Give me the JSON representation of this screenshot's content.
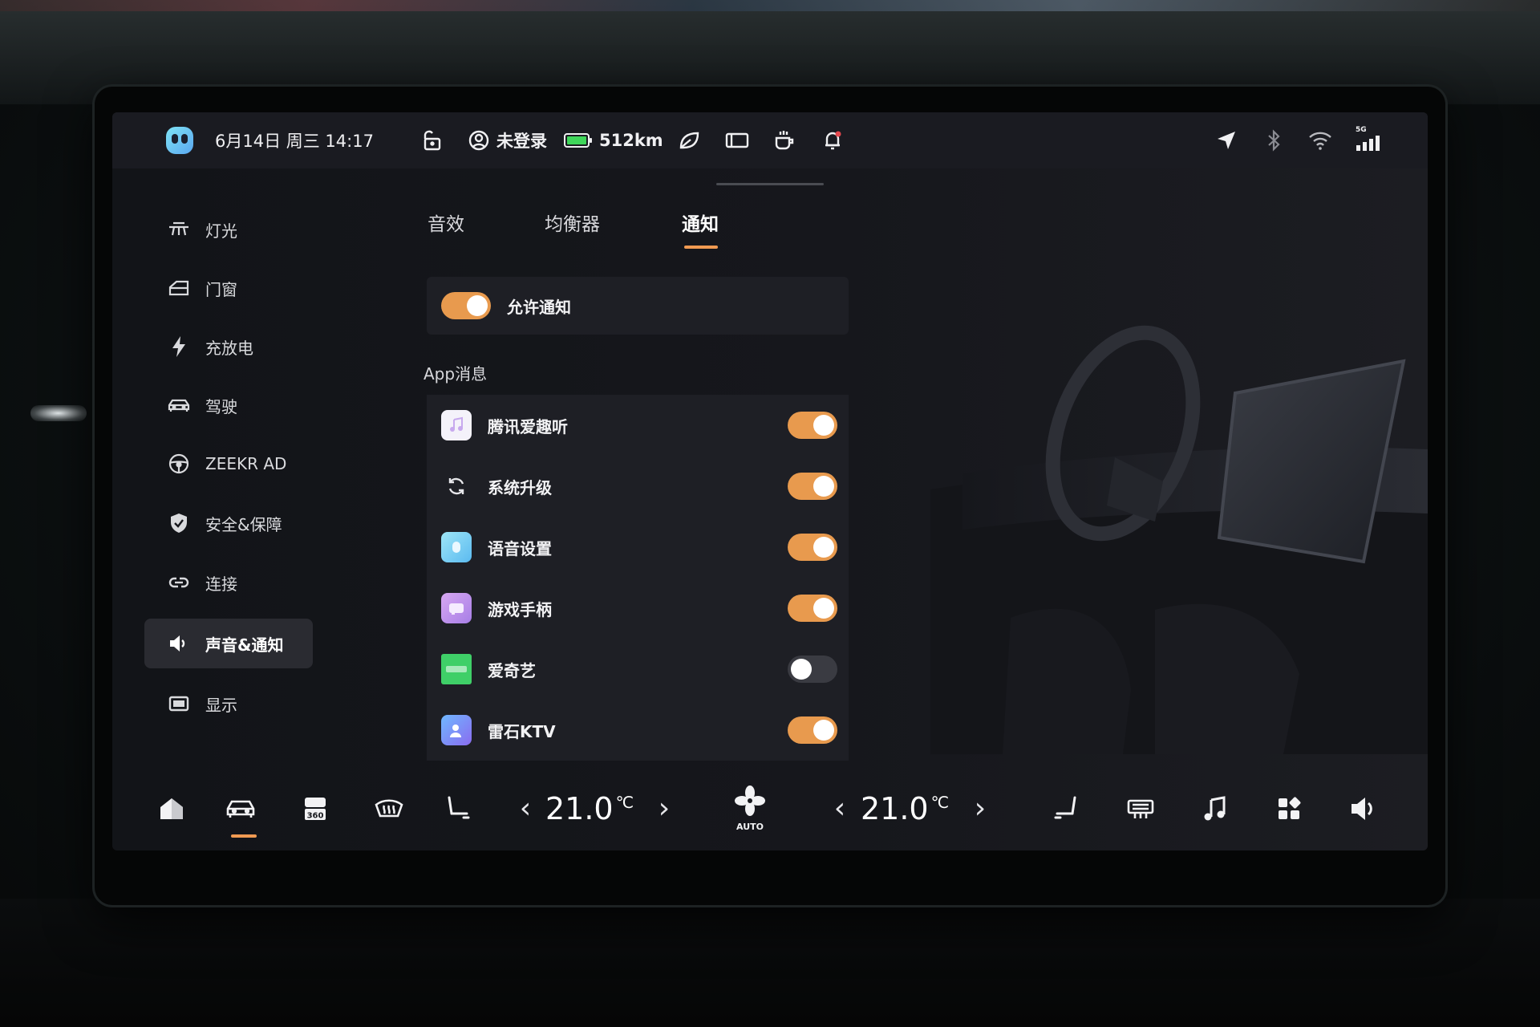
{
  "status_bar": {
    "date_time": "6月14日 周三 14:17",
    "user": "未登录",
    "range": "512km",
    "network_badge": "5G"
  },
  "sidebar": {
    "items": [
      {
        "label": "灯光",
        "icon": "light-icon"
      },
      {
        "label": "门窗",
        "icon": "door-icon"
      },
      {
        "label": "充放电",
        "icon": "bolt-icon"
      },
      {
        "label": "驾驶",
        "icon": "car-icon"
      },
      {
        "label": "ZEEKR AD",
        "icon": "steering-wheel-icon"
      },
      {
        "label": "安全&保障",
        "icon": "shield-icon"
      },
      {
        "label": "连接",
        "icon": "link-icon"
      },
      {
        "label": "声音&通知",
        "icon": "speaker-icon",
        "active": true
      },
      {
        "label": "显示",
        "icon": "display-icon"
      }
    ]
  },
  "tabs": [
    {
      "label": "音效"
    },
    {
      "label": "均衡器"
    },
    {
      "label": "通知",
      "active": true
    }
  ],
  "allow_notifications": {
    "label": "允许通知",
    "on": true
  },
  "app_section_label": "App消息",
  "apps": [
    {
      "name": "腾讯爱趣听",
      "on": true
    },
    {
      "name": "系统升级",
      "on": true
    },
    {
      "name": "语音设置",
      "on": true
    },
    {
      "name": "游戏手柄",
      "on": true
    },
    {
      "name": "爱奇艺",
      "on": false
    },
    {
      "name": "雷石KTV",
      "on": true
    }
  ],
  "climate": {
    "left_temp": "21.0",
    "right_temp": "21.0",
    "unit": "℃",
    "fan_mode": "AUTO"
  },
  "colors": {
    "accent": "#e89a4e",
    "toggle_off": "#3a3b42",
    "panel": "#1e1f25"
  }
}
